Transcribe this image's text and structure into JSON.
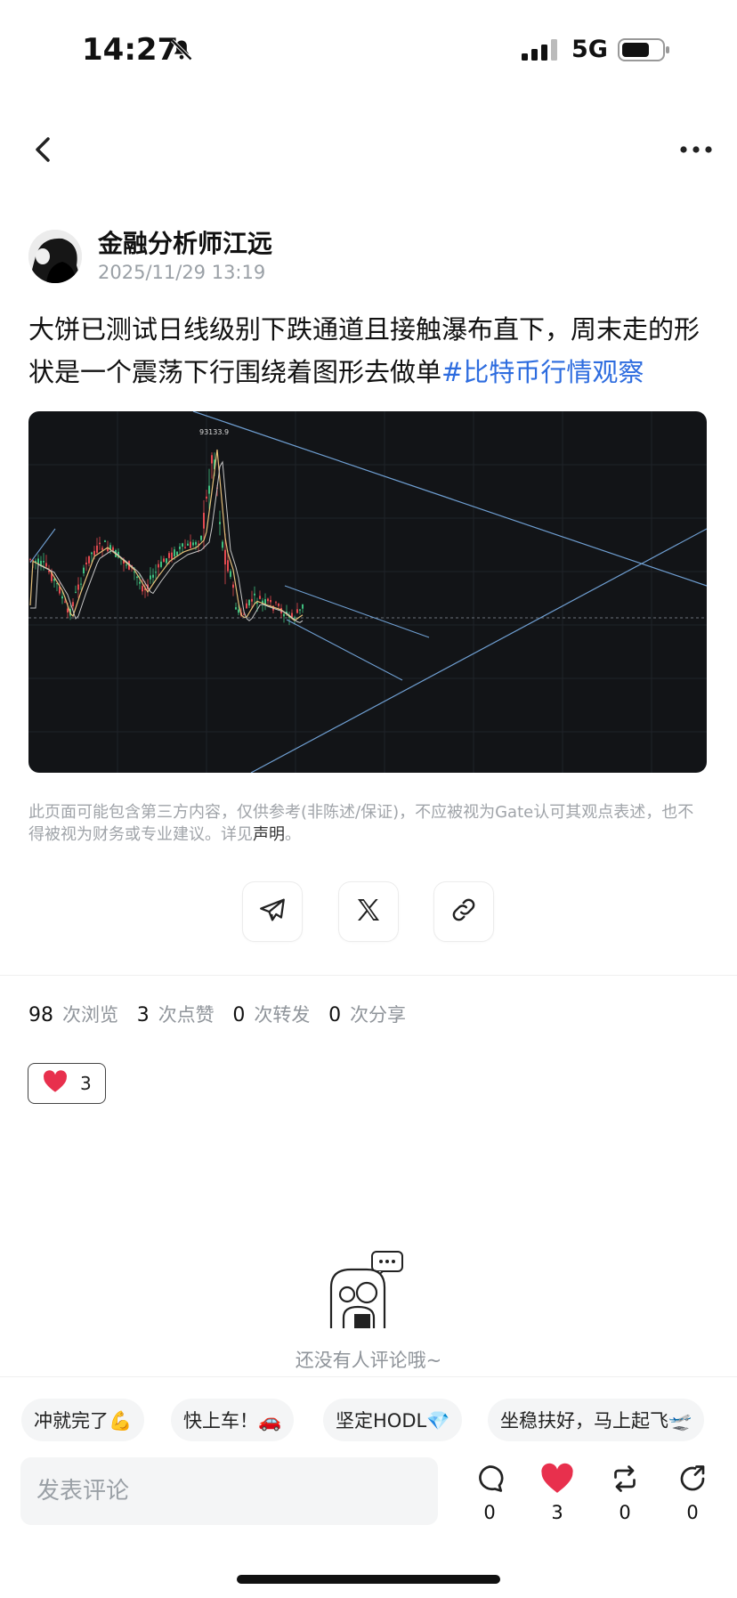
{
  "status_bar": {
    "time": "14:27",
    "network": "5G"
  },
  "author": {
    "name": "金融分析师江远",
    "timestamp": "2025/11/29 13:19"
  },
  "post": {
    "text": "大饼已测试日线级别下跌通道且接触瀑布直下，周末走的形状是一个震荡下行围绕着图形去做单",
    "hashtag": "#比特币行情观察"
  },
  "chart_image": {
    "peak_label": "93133.9"
  },
  "disclaimer": {
    "text": "此页面可能包含第三方内容，仅供参考(非陈述/保证)，不应被视为Gate认可其观点表述，也不得被视为财务或专业建议。详见",
    "link": "声明",
    "suffix": "。"
  },
  "share_icons": [
    "telegram-icon",
    "x-icon",
    "link-icon"
  ],
  "stats": {
    "views": {
      "count": "98",
      "label": "次浏览"
    },
    "likes": {
      "count": "3",
      "label": "次点赞"
    },
    "reposts": {
      "count": "0",
      "label": "次转发"
    },
    "shares": {
      "count": "0",
      "label": "次分享"
    }
  },
  "reaction": {
    "count": "3"
  },
  "empty_comments": {
    "text": "还没有人评论哦~"
  },
  "quick_replies": [
    {
      "label": "冲就完了💪"
    },
    {
      "label": "快上车！🚗"
    },
    {
      "label": "坚定HODL💎"
    },
    {
      "label": "坐稳扶好，马上起飞🛫"
    }
  ],
  "comment_box": {
    "placeholder": "发表评论"
  },
  "actions": {
    "comment": {
      "count": "0"
    },
    "like": {
      "count": "3"
    },
    "repost": {
      "count": "0"
    },
    "share": {
      "count": "0"
    }
  },
  "colors": {
    "accent": "#2d6cdf",
    "like": "#e8304d",
    "chart_bg": "#121417"
  }
}
